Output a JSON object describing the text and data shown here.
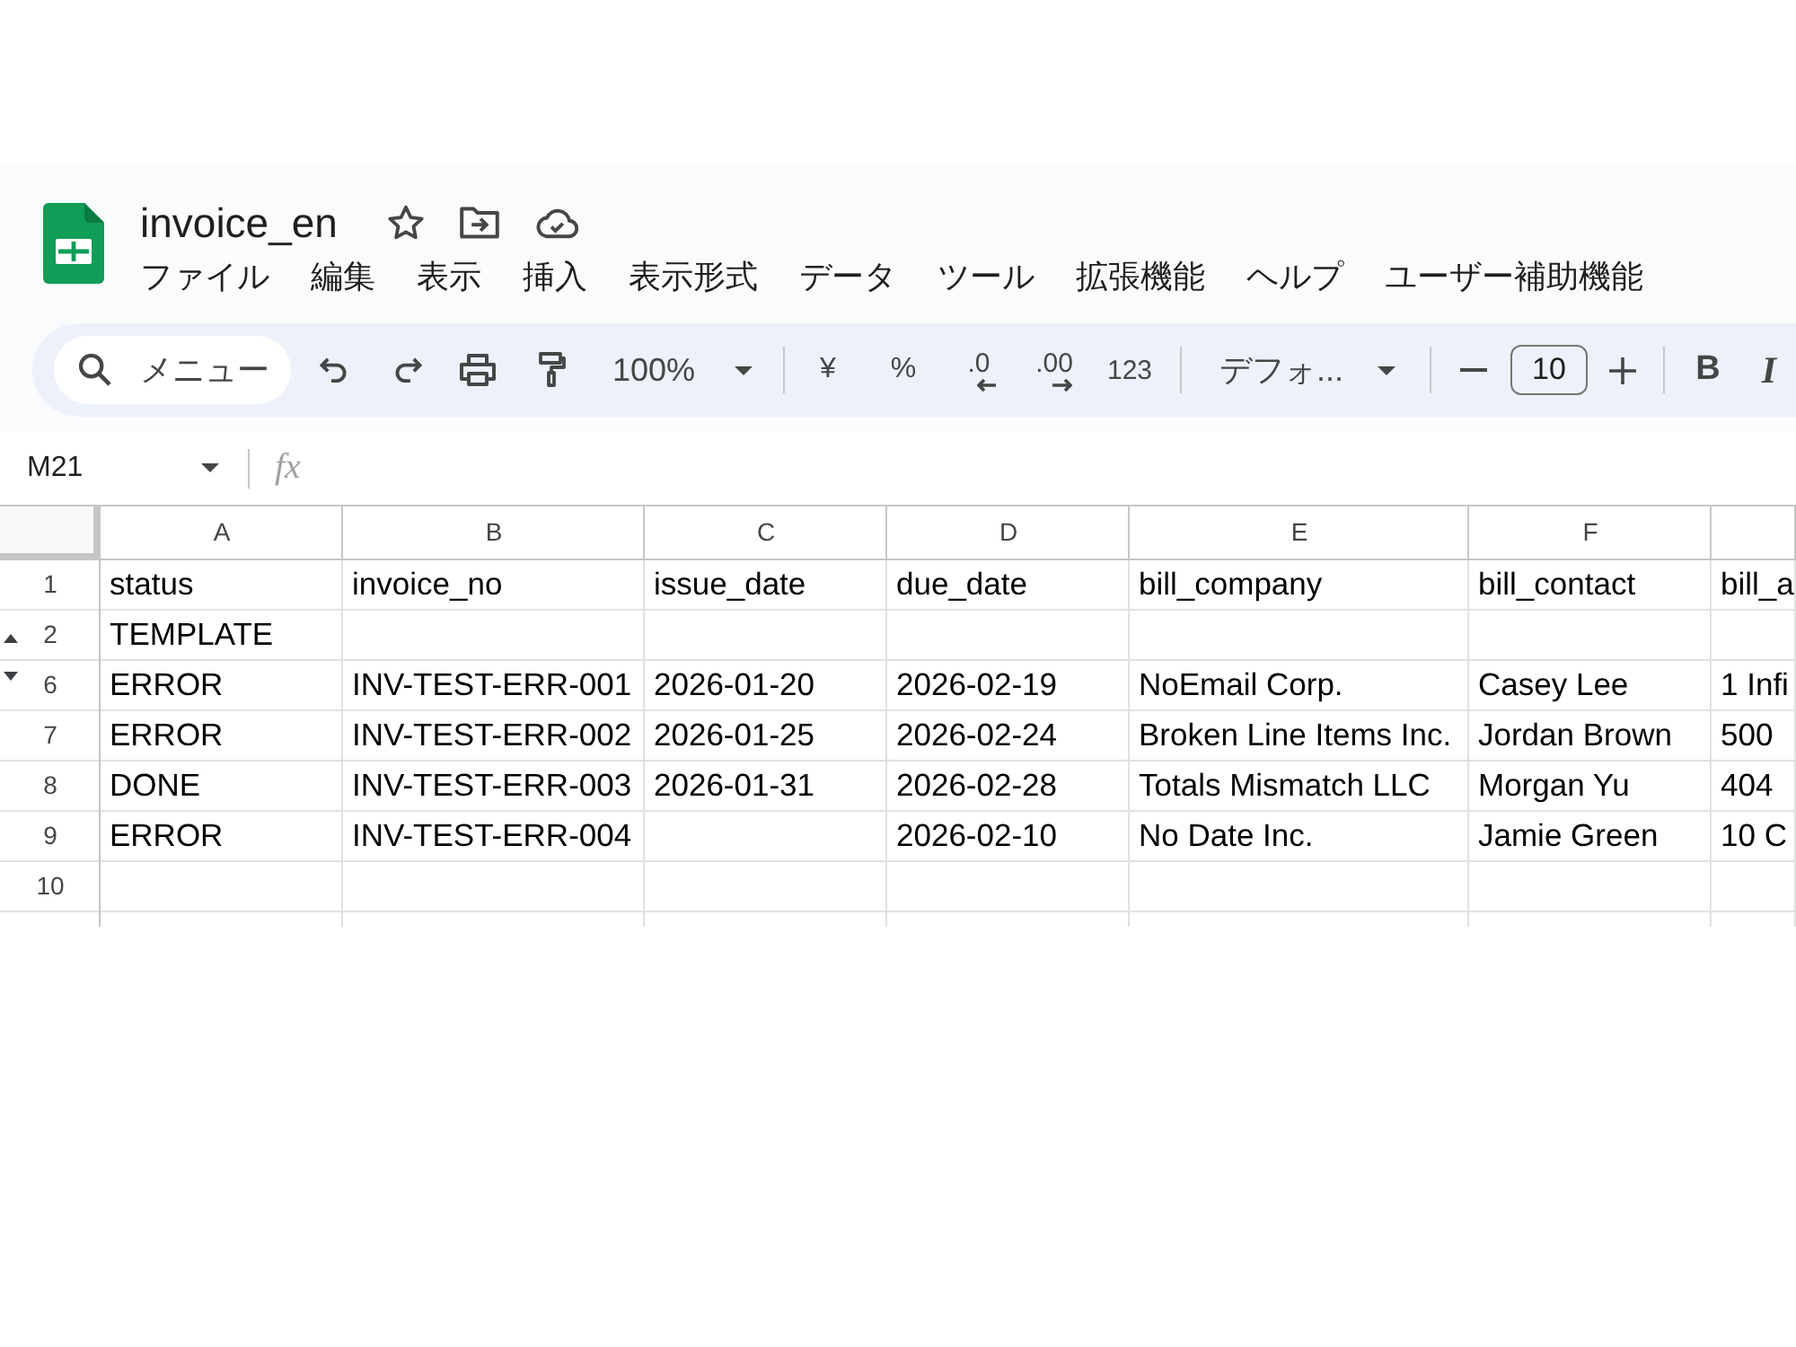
{
  "document": {
    "title": "invoice_en"
  },
  "menu": [
    "ファイル",
    "編集",
    "表示",
    "挿入",
    "表示形式",
    "データ",
    "ツール",
    "拡張機能",
    "ヘルプ",
    "ユーザー補助機能"
  ],
  "toolbar": {
    "search": {
      "placeholder": "メニュー"
    },
    "zoom": "100%",
    "currency": "¥",
    "percent": "%",
    "decrease_decimals": ".0",
    "increase_decimals": ".00",
    "more_formats": "123",
    "font": "デフォ...",
    "font_size": "10",
    "bold": "B",
    "italic": "I"
  },
  "formula_bar": {
    "cell_ref": "M21",
    "fx": "fx"
  },
  "grid": {
    "columns": [
      "A",
      "B",
      "C",
      "D",
      "E",
      "F"
    ],
    "rows": [
      {
        "number": "1",
        "hidden_before": false,
        "hidden_after": false,
        "cells": [
          "status",
          "invoice_no",
          "issue_date",
          "due_date",
          "bill_company",
          "bill_contact",
          "bill_a"
        ]
      },
      {
        "number": "2",
        "hidden_before": false,
        "hidden_after": true,
        "cells": [
          "TEMPLATE"
        ]
      },
      {
        "number": "6",
        "hidden_before": true,
        "hidden_after": false,
        "cells": [
          "ERROR",
          "INV-TEST-ERR-001",
          "2026-01-20",
          "2026-02-19",
          "NoEmail Corp.",
          "Casey Lee",
          "1 Infi"
        ]
      },
      {
        "number": "7",
        "hidden_before": false,
        "hidden_after": false,
        "cells": [
          "ERROR",
          "INV-TEST-ERR-002",
          "2026-01-25",
          "2026-02-24",
          "Broken Line Items Inc.",
          "Jordan Brown",
          "500"
        ]
      },
      {
        "number": "8",
        "hidden_before": false,
        "hidden_after": false,
        "cells": [
          "DONE",
          "INV-TEST-ERR-003",
          "2026-01-31",
          "2026-02-28",
          "Totals Mismatch LLC",
          "Morgan Yu",
          "404"
        ]
      },
      {
        "number": "9",
        "hidden_before": false,
        "hidden_after": false,
        "cells": [
          "ERROR",
          "INV-TEST-ERR-004",
          null,
          "2026-02-10",
          "No Date Inc.",
          "Jamie Green",
          "10 C"
        ]
      },
      {
        "number": "10",
        "hidden_before": false,
        "hidden_after": false
      }
    ]
  }
}
